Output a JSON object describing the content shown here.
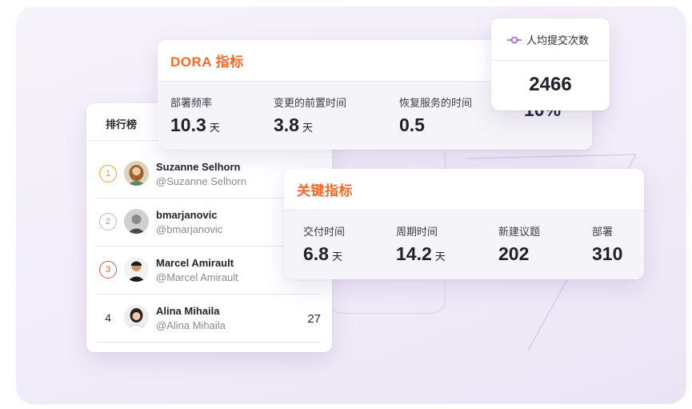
{
  "leaderboard": {
    "tab_label": "排行榜",
    "rows": [
      {
        "rank": "1",
        "name": "Suzanne Selhorn",
        "handle": "@Suzanne Selhorn",
        "score": ""
      },
      {
        "rank": "2",
        "name": "bmarjanovic",
        "handle": "@bmarjanovic",
        "score": ""
      },
      {
        "rank": "3",
        "name": "Marcel Amirault",
        "handle": "@Marcel Amirault",
        "score": ""
      },
      {
        "rank": "4",
        "name": "Alina Mihaila",
        "handle": "@Alina Mihaila",
        "score": "27"
      }
    ]
  },
  "dora": {
    "title": "DORA 指标",
    "metrics": [
      {
        "label": "部署频率",
        "value": "10.3",
        "unit": "天"
      },
      {
        "label": "变更的前置时间",
        "value": "3.8",
        "unit": "天"
      },
      {
        "label": "恢复服务的时间",
        "value": "0.5",
        "unit": ""
      },
      {
        "label": "",
        "value": "10%",
        "unit": ""
      }
    ]
  },
  "commits_card": {
    "label": "人均提交次数",
    "value": "2466",
    "icon": "commit-icon"
  },
  "key_metrics": {
    "title": "关键指标",
    "metrics": [
      {
        "label": "交付时间",
        "value": "6.8",
        "unit": "天"
      },
      {
        "label": "周期时间",
        "value": "14.2",
        "unit": "天"
      },
      {
        "label": "新建议题",
        "value": "202",
        "unit": ""
      },
      {
        "label": "部署",
        "value": "310",
        "unit": ""
      }
    ]
  },
  "colors": {
    "accent_orange": "#f26a28",
    "rank1": "#f0a030",
    "rank2": "#b8b8c4",
    "rank3": "#e05a4a",
    "commit_icon": "#9b59d6"
  }
}
